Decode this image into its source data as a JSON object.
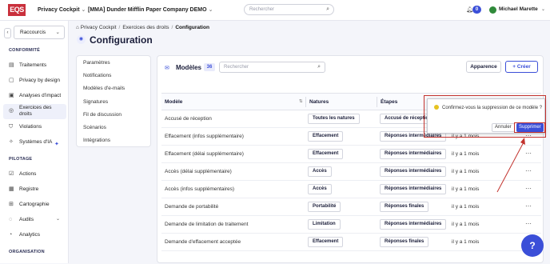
{
  "topbar": {
    "logo": "EQS",
    "product": "Privacy Cockpit",
    "company": "[MMA] Dunder Mifflin Paper Company DEMO",
    "search_placeholder": "Rechercher",
    "notifications_count": "0",
    "user_name": "Michael Marette"
  },
  "sidebar": {
    "shortcuts_label": "Raccourcis",
    "section_conformite": "CONFORMITÉ",
    "section_pilotage": "PILOTAGE",
    "section_organisation": "ORGANISATION",
    "items": [
      {
        "label": "Traitements"
      },
      {
        "label": "Privacy by design"
      },
      {
        "label": "Analyses d'impact"
      },
      {
        "label": "Exercices des droits"
      },
      {
        "label": "Violations"
      },
      {
        "label": "Systèmes d'IA"
      },
      {
        "label": "Actions"
      },
      {
        "label": "Registre"
      },
      {
        "label": "Cartographie"
      },
      {
        "label": "Audits"
      },
      {
        "label": "Analytics"
      }
    ]
  },
  "breadcrumb": [
    "Privacy Cockpit",
    "Exercices des droits",
    "Configuration"
  ],
  "page_title": "Configuration",
  "settings_menu": [
    "Paramètres",
    "Notifications",
    "Modèles d'e-mails",
    "Signatures",
    "Fil de discussion",
    "Scénarios",
    "Intégrations"
  ],
  "panel": {
    "title": "Modèles",
    "count": "36",
    "search_placeholder": "Rechercher",
    "appearance_button": "Apparence",
    "create_button": "Créer",
    "columns": [
      "Modèle",
      "Natures",
      "Étapes"
    ],
    "rows": [
      {
        "model": "Accusé de réception",
        "nature": "Toutes les natures",
        "step": "Accusé de réception",
        "modified": ""
      },
      {
        "model": "Effacement (infos supplémentaire)",
        "nature": "Effacement",
        "step": "Réponses intermédiaires",
        "modified": "il y a 1 mois"
      },
      {
        "model": "Effacement (délai supplémentaire)",
        "nature": "Effacement",
        "step": "Réponses intermédiaires",
        "modified": "il y a 1 mois"
      },
      {
        "model": "Accès (délai supplémentaire)",
        "nature": "Accès",
        "step": "Réponses intermédiaires",
        "modified": "il y a 1 mois"
      },
      {
        "model": "Accès (infos supplémentaires)",
        "nature": "Accès",
        "step": "Réponses intermédiaires",
        "modified": "il y a 1 mois"
      },
      {
        "model": "Demande de portabilité",
        "nature": "Portabilité",
        "step": "Réponses finales",
        "modified": "il y a 1 mois"
      },
      {
        "model": "Demande de limitation de traitement",
        "nature": "Limitation",
        "step": "Réponses intermédiaires",
        "modified": "il y a 1 mois"
      },
      {
        "model": "Demande d'effacement acceptée",
        "nature": "Effacement",
        "step": "Réponses finales",
        "modified": "il y a 1 mois"
      }
    ]
  },
  "confirm_popover": {
    "message": "Confirmez-vous la suppression de ce modèle ?",
    "cancel_label": "Annuler",
    "delete_label": "Supprimer"
  },
  "colors": {
    "accent": "#3b4fd8",
    "brand": "#c9303c",
    "annotation": "#c2322d"
  }
}
